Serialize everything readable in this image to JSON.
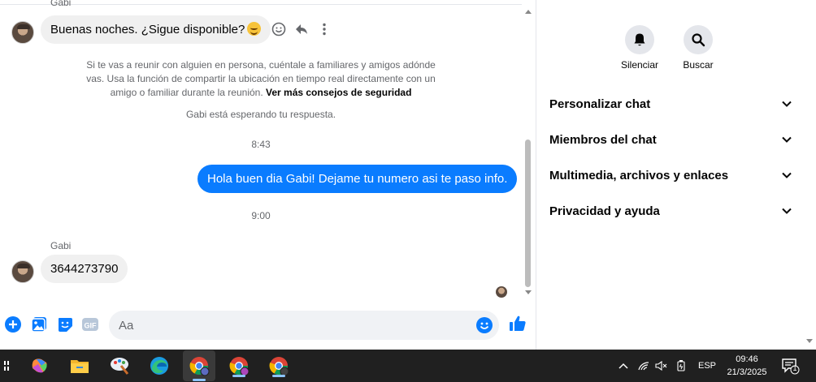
{
  "chat": {
    "messages": [
      {
        "sender": "Gabi",
        "text": "Buenas noches. ¿Sigue disponible?",
        "emoji": "smiling-face-icon"
      },
      {
        "sender": "Gabi",
        "text": "3644273790"
      }
    ],
    "safety_notice": {
      "line1": "Si te vas a reunir con alguien en persona, cuéntale a familiares y amigos adónde",
      "line2": "vas. Usa la función de compartir la ubicación en tiempo real directamente con un",
      "line3_prefix": "amigo o familiar durante la reunión.",
      "link": "Ver más consejos de seguridad"
    },
    "waiting_status": "Gabi está esperando tu respuesta.",
    "timestamp_1": "8:43",
    "outgoing_message": "Hola buen dia Gabi! Dejame tu numero asi te paso info.",
    "timestamp_2": "9:00",
    "composer_placeholder": "Aa"
  },
  "info": {
    "quick_actions": [
      {
        "label": "Silenciar",
        "icon": "bell-icon"
      },
      {
        "label": "Buscar",
        "icon": "search-icon"
      }
    ],
    "sections": [
      "Personalizar chat",
      "Miembros del chat",
      "Multimedia, archivos y enlaces",
      "Privacidad y ayuda"
    ]
  },
  "taskbar": {
    "language": "ESP",
    "time": "09:46",
    "date": "21/3/2025",
    "notification_count": "1"
  },
  "colors": {
    "messenger_blue": "#0a7cff",
    "incoming_bubble": "#f0f0f0",
    "taskbar": "#202020"
  }
}
